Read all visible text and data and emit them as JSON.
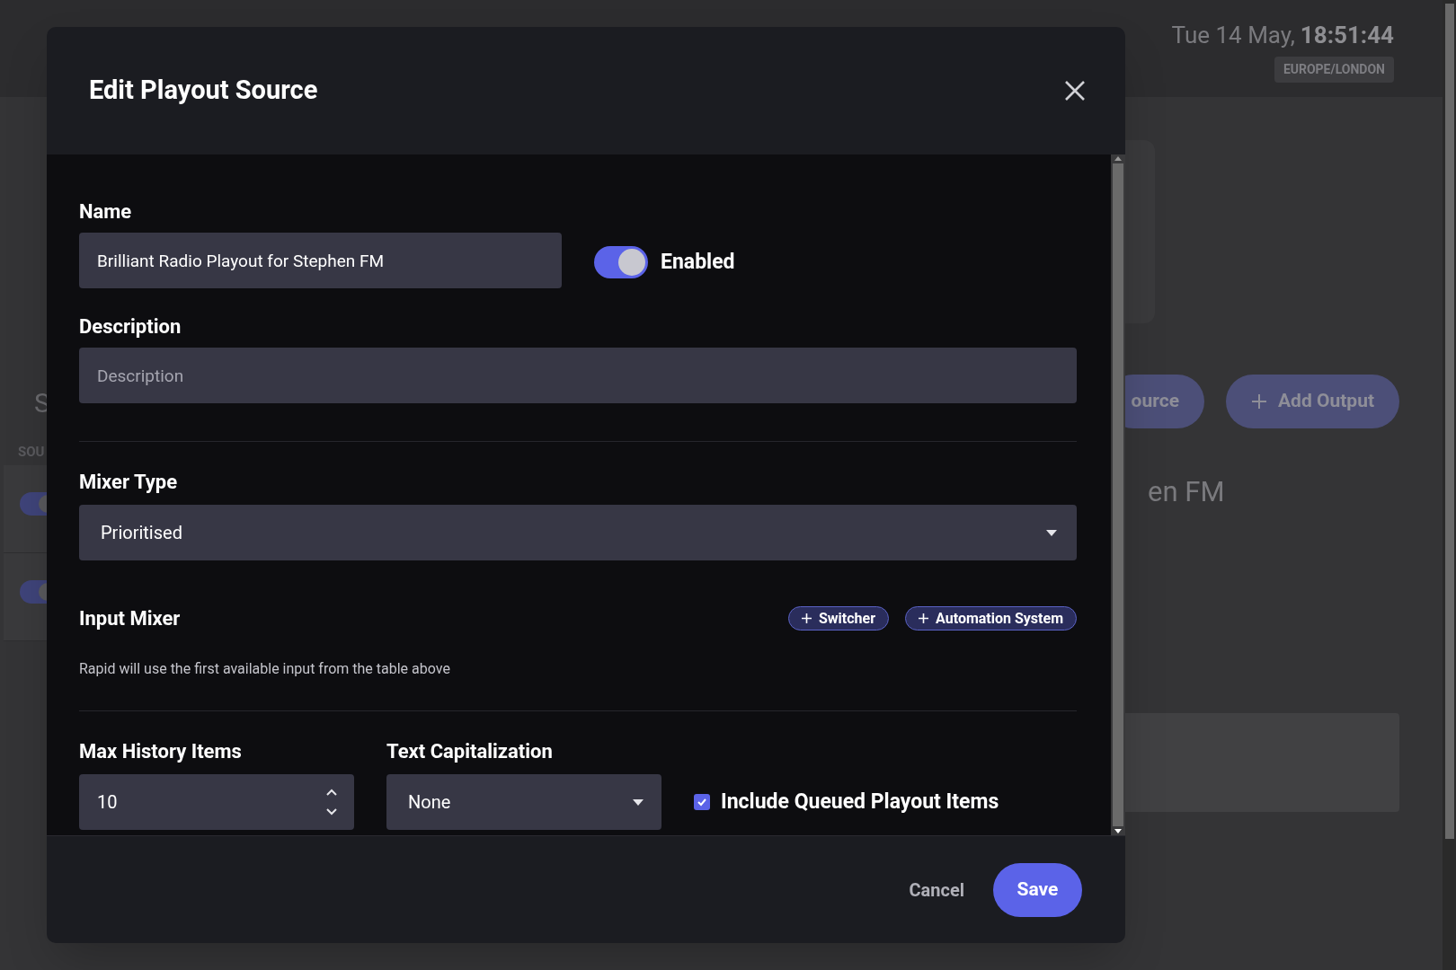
{
  "background": {
    "clock": {
      "date": "Tue 14 May,",
      "time": "18:51:44",
      "timezone": "EUROPE/LONDON"
    },
    "heading": "S",
    "section_label": "SOU",
    "source_toggles": [
      {
        "on": true
      },
      {
        "on": true
      }
    ],
    "buttons": [
      {
        "label": "ource"
      },
      {
        "label": "Add Output"
      }
    ],
    "title": "en FM"
  },
  "modal": {
    "title": "Edit Playout Source",
    "name": {
      "label": "Name",
      "value": "Brilliant Radio Playout for Stephen FM"
    },
    "enabled": {
      "label": "Enabled",
      "on": true
    },
    "description": {
      "label": "Description",
      "placeholder": "Description"
    },
    "mixer_type": {
      "label": "Mixer Type",
      "value": "Prioritised"
    },
    "input_mixer": {
      "label": "Input Mixer",
      "add_buttons": [
        "Switcher",
        "Automation System"
      ],
      "help": "Rapid will use the first available input from the table above"
    },
    "max_history": {
      "label": "Max History Items",
      "value": "10"
    },
    "text_capitalization": {
      "label": "Text Capitalization",
      "value": "None"
    },
    "include_queued": {
      "label": "Include Queued Playout Items",
      "checked": true
    },
    "buttons": {
      "cancel": "Cancel",
      "save": "Save"
    }
  }
}
